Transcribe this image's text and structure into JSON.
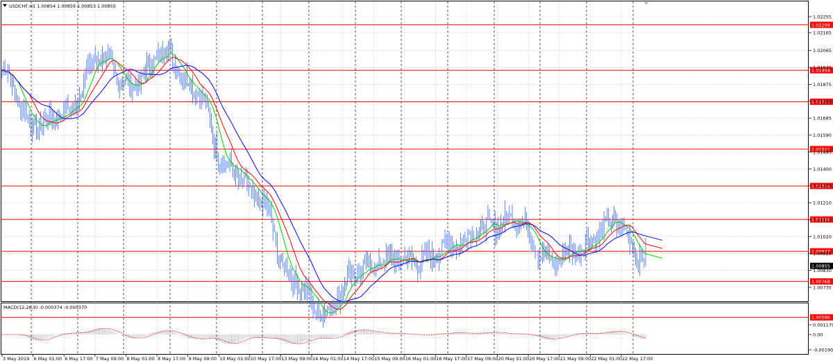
{
  "window": {
    "title": "USDCHF,H1  1.00854 1.00859 1.00853 1.00855",
    "indicator_title": "MACD(12,26,9) -0.000374 -0.000370"
  },
  "colors": {
    "background": "#ffffff",
    "candles": "#3366ff",
    "ma_fast": "#00cc00",
    "ma_mid": "#ff0000",
    "ma_slow": "#0000ff",
    "levels": "#ff0000",
    "grid": "#c0c0c0",
    "macd_hist": "#b0b0b0",
    "macd_signal": "#ff0000"
  },
  "price_axis": {
    "ticks": [
      "1.02255",
      "1.02165",
      "1.02065",
      "1.01970",
      "1.01875",
      "1.01780",
      "1.01685",
      "1.01590",
      "1.01495",
      "1.01400",
      "1.01305",
      "1.01210",
      "1.01115",
      "1.01020",
      "1.00925",
      "1.00830",
      "1.00735",
      "1.00640",
      "1.00545",
      "1.00450"
    ],
    "current_price": "1.00855"
  },
  "levels": [
    "1.02209",
    "1.01954",
    "1.01777",
    "1.01511",
    "1.01304",
    "1.01116",
    "1.00937",
    "1.00768",
    "1.00566"
  ],
  "macd_axis": {
    "ticks": [
      "0.001179",
      "0.00",
      "-0.001902"
    ]
  },
  "time_axis": {
    "labels": [
      "3 May 2019",
      "6 May 01:00",
      "6 May 17:00",
      "7 May 09:00",
      "8 May 01:00",
      "8 May 17:00",
      "9 May 09:00",
      "10 May 01:00",
      "10 May 17:00",
      "13 May 09:00",
      "14 May 01:00",
      "14 May 17:00",
      "15 May 09:00",
      "16 May 01:00",
      "16 May 17:00",
      "17 May 09:00",
      "20 May 01:00",
      "20 May 17:00",
      "21 May 09:00",
      "22 May 01:00",
      "22 May 17:00"
    ]
  },
  "chart_data": {
    "type": "line",
    "symbol": "USDCHF",
    "timeframe": "H1",
    "ylim": [
      1.0045,
      1.02255
    ],
    "x": [
      "3 May 2019",
      "6 May 01:00",
      "6 May 17:00",
      "7 May 09:00",
      "8 May 01:00",
      "8 May 17:00",
      "9 May 09:00",
      "10 May 01:00",
      "10 May 17:00",
      "13 May 09:00",
      "14 May 01:00",
      "14 May 17:00",
      "15 May 09:00",
      "16 May 01:00",
      "16 May 17:00",
      "17 May 09:00",
      "20 May 01:00",
      "20 May 17:00",
      "21 May 09:00",
      "22 May 01:00",
      "22 May 17:00"
    ],
    "series": [
      {
        "values": [
          1.0195,
          1.0164,
          1.0172,
          1.0203,
          1.0186,
          1.0206,
          1.0185,
          1.0141,
          1.0123,
          1.0078,
          1.0059,
          1.0082,
          1.0089,
          1.0088,
          1.0098,
          1.0107,
          1.0112,
          1.0088,
          1.0096,
          1.011,
          1.009
        ]
      }
    ],
    "horizontal_levels": [
      1.02209,
      1.01954,
      1.01777,
      1.01511,
      1.01304,
      1.01116,
      1.00937,
      1.00768,
      1.00566
    ]
  }
}
